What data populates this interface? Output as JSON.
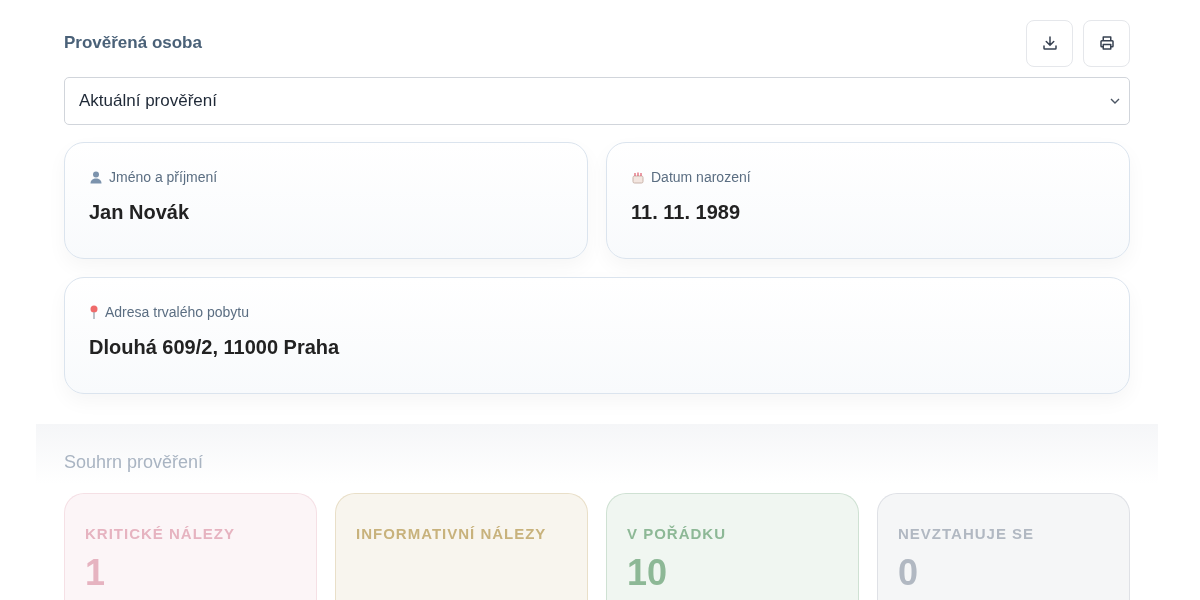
{
  "header": {
    "title": "Prověřená osoba"
  },
  "select": {
    "value": "Aktuální prověření"
  },
  "info_cards": [
    {
      "kind": "person",
      "label": "Jméno a příjmení",
      "value": "Jan Novák"
    },
    {
      "kind": "birthday",
      "label": "Datum narození",
      "value": "11. 11. 1989"
    },
    {
      "kind": "address",
      "label": "Adresa trvalého pobytu",
      "value": "Dlouhá 609/2, 11000 Praha"
    }
  ],
  "summary": {
    "title": "Souhrn prověření",
    "stats": [
      {
        "label": "KRITICKÉ NÁLEZY",
        "count": "1",
        "color": "#e6b3c0"
      },
      {
        "label": "INFORMATIVNÍ NÁLEZY",
        "color": "#c8b27c"
      },
      {
        "label": "V POŘÁDKU",
        "count": "10",
        "color": "#8db896"
      },
      {
        "label": "NEVZTAHUJE SE",
        "count": "0",
        "color": "#b1b8c2"
      }
    ]
  }
}
